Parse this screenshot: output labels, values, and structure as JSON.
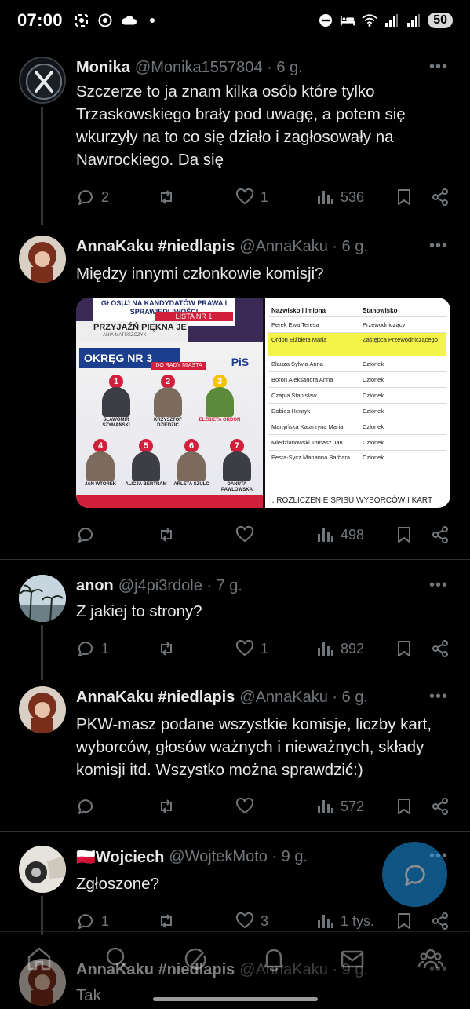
{
  "status_bar": {
    "time": "07:00",
    "battery": "50",
    "left_icons": [
      "screenshot-icon",
      "chrome-icon",
      "cloud-icon",
      "dot-icon"
    ],
    "right_icons": [
      "dnd-icon",
      "bed-icon",
      "wifi-icon",
      "signal-icon",
      "signal-icon"
    ]
  },
  "tweets": [
    {
      "name": "Monika",
      "handle": "@Monika1557804 · 6 g.",
      "text": "Szczerze to ja znam kilka osób które tylko Trzaskowskiego brały pod uwagę, a potem się wkurzyły na to co się działo i zagłosowały na Nawrockiego. Da się",
      "replies": "2",
      "retweets": "",
      "likes": "1",
      "views": "536"
    },
    {
      "name": "AnnaKaku #niedlapis",
      "handle": "@AnnaKaku · 6 g.",
      "text": "Między innymi członkowie komisji?",
      "replies": "",
      "retweets": "",
      "likes": "",
      "views": "498",
      "media": {
        "left": {
          "banner_top": "GŁOSUJ NA KANDYDATÓW PRAWA I SPRAWIEDLIWOŚCI",
          "lista": "LISTA NR 1",
          "przyjazn": "PRZYJAŹŃ PIĘKNA JE",
          "author": "ANIA MATUSZCZYK",
          "okreg": "OKRĘG NR 3",
          "do_rady": "DO RADY MIASTA",
          "pis": "PiS",
          "candidates": [
            {
              "num": "1",
              "name": "SŁAWOMIR SZYMAŃSKI"
            },
            {
              "num": "2",
              "name": "KRZYSZTOF DZIEDZIC"
            },
            {
              "num": "3",
              "name": "ELŻBIETA ORDON"
            },
            {
              "num": "4",
              "name": "JAN WTOREK"
            },
            {
              "num": "5",
              "name": "ALICJA BERTRAM"
            },
            {
              "num": "6",
              "name": "ARLETA SZULC"
            },
            {
              "num": "7",
              "name": "DANUTA PAWLOWSKA"
            }
          ]
        },
        "right": {
          "col1": "Nazwisko i imiona",
          "col2": "Stanowisko",
          "rows": [
            [
              "Perek Ewa Teresa",
              "Przewodniczący"
            ],
            [
              "Ordon Elżbieta Maria",
              "Zastępca Przewodniczącego"
            ],
            [
              "Blauza Sylwia Anna",
              "Członek"
            ],
            [
              "Boroń Aleksandra Anna",
              "Członek"
            ],
            [
              "Czapla Stanisław",
              "Członek"
            ],
            [
              "Dobies Henryk",
              "Członek"
            ],
            [
              "Martyńska Katarzyna Maria",
              "Członek"
            ],
            [
              "Miedzianowski Tomasz Jan",
              "Członek"
            ],
            [
              "Pesta-Sycz Marianna Barbara",
              "Członek"
            ]
          ],
          "footer": "I. ROZLICZENIE SPISU WYBORCÓW I KART"
        }
      }
    },
    {
      "name": "anon",
      "handle": "@j4pi3rdole · 7 g.",
      "text": "Z jakiej to strony?",
      "replies": "1",
      "retweets": "",
      "likes": "1",
      "views": "892"
    },
    {
      "name": "AnnaKaku #niedlapis",
      "handle": "@AnnaKaku · 6 g.",
      "text": "PKW-masz podane wszystkie komisje, liczby kart, wyborców, głosów ważnych i nieważnych, składy komisji itd. Wszystko można sprawdzić:)",
      "replies": "",
      "retweets": "",
      "likes": "",
      "views": "572"
    },
    {
      "name": "🇵🇱Wojciech",
      "handle": "@WojtekMoto · 9 g.",
      "text": "Zgłoszone?",
      "replies": "1",
      "retweets": "",
      "likes": "3",
      "views": "1 tys."
    },
    {
      "name": "AnnaKaku #niedlapis",
      "handle": "@AnnaKaku · 9 g.",
      "text": "Tak"
    }
  ],
  "bottom_nav": [
    "home-icon",
    "search-icon",
    "grok-icon",
    "notifications-icon",
    "messages-icon",
    "communities-icon"
  ],
  "colors": {
    "background": "#000000",
    "text": "#e7e9ea",
    "muted": "#71767b",
    "accent": "#1d9bf0",
    "divider": "#2f3336"
  }
}
